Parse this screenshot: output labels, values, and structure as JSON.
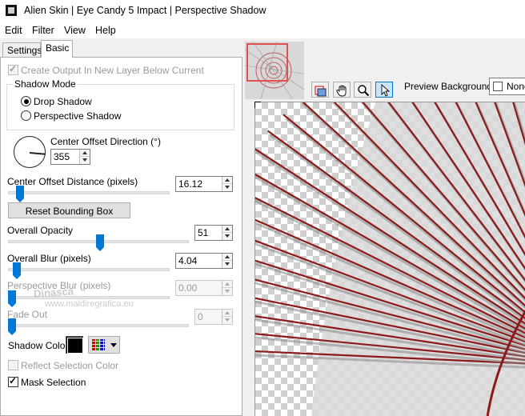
{
  "window": {
    "title": "Alien Skin | Eye Candy 5 Impact | Perspective Shadow"
  },
  "menu": {
    "items": [
      "Edit",
      "Filter",
      "View",
      "Help"
    ]
  },
  "tabs": {
    "settings": "Settings",
    "basic": "Basic"
  },
  "basic": {
    "create_output_label": "Create Output In New Layer Below Current",
    "create_output_checked": true,
    "shadow_mode": {
      "title": "Shadow Mode",
      "options": [
        "Drop Shadow",
        "Perspective Shadow"
      ],
      "selected": "Drop Shadow"
    },
    "center_offset_direction": {
      "label": "Center Offset Direction (°)",
      "value": "355"
    },
    "center_offset_distance": {
      "label": "Center Offset Distance (pixels)",
      "value": "16.12",
      "slider_fraction": 0.05
    },
    "reset_bounding_box_label": "Reset Bounding Box",
    "overall_opacity": {
      "label": "Overall Opacity",
      "value": "51",
      "slider_fraction": 0.51
    },
    "overall_blur": {
      "label": "Overall Blur (pixels)",
      "value": "4.04",
      "slider_fraction": 0.03
    },
    "perspective_blur": {
      "label": "Perspective Blur (pixels)",
      "value": "0.00",
      "slider_fraction": 0.0
    },
    "fade_out": {
      "label": "Fade Out",
      "value": "0",
      "slider_fraction": 0.0
    },
    "shadow_color": {
      "label": "Shadow Color",
      "color": "#000000"
    },
    "reflect_selection_color_label": "Reflect Selection Color",
    "reflect_selection_color_checked": false,
    "mask_selection_label": "Mask Selection",
    "mask_selection_checked": true
  },
  "watermark": {
    "line1": "Dinasca",
    "line2": "www.maldiregrafica.eu"
  },
  "preview": {
    "background_label": "Preview Background:",
    "background_value": "None",
    "tools": [
      "navigator-icon",
      "hand-icon",
      "zoom-icon",
      "select-arrow-icon"
    ],
    "stripe_color": "#8b1a1a"
  },
  "colors": {
    "accent": "#0078d7",
    "thumbnail_frame": "#e05050"
  }
}
